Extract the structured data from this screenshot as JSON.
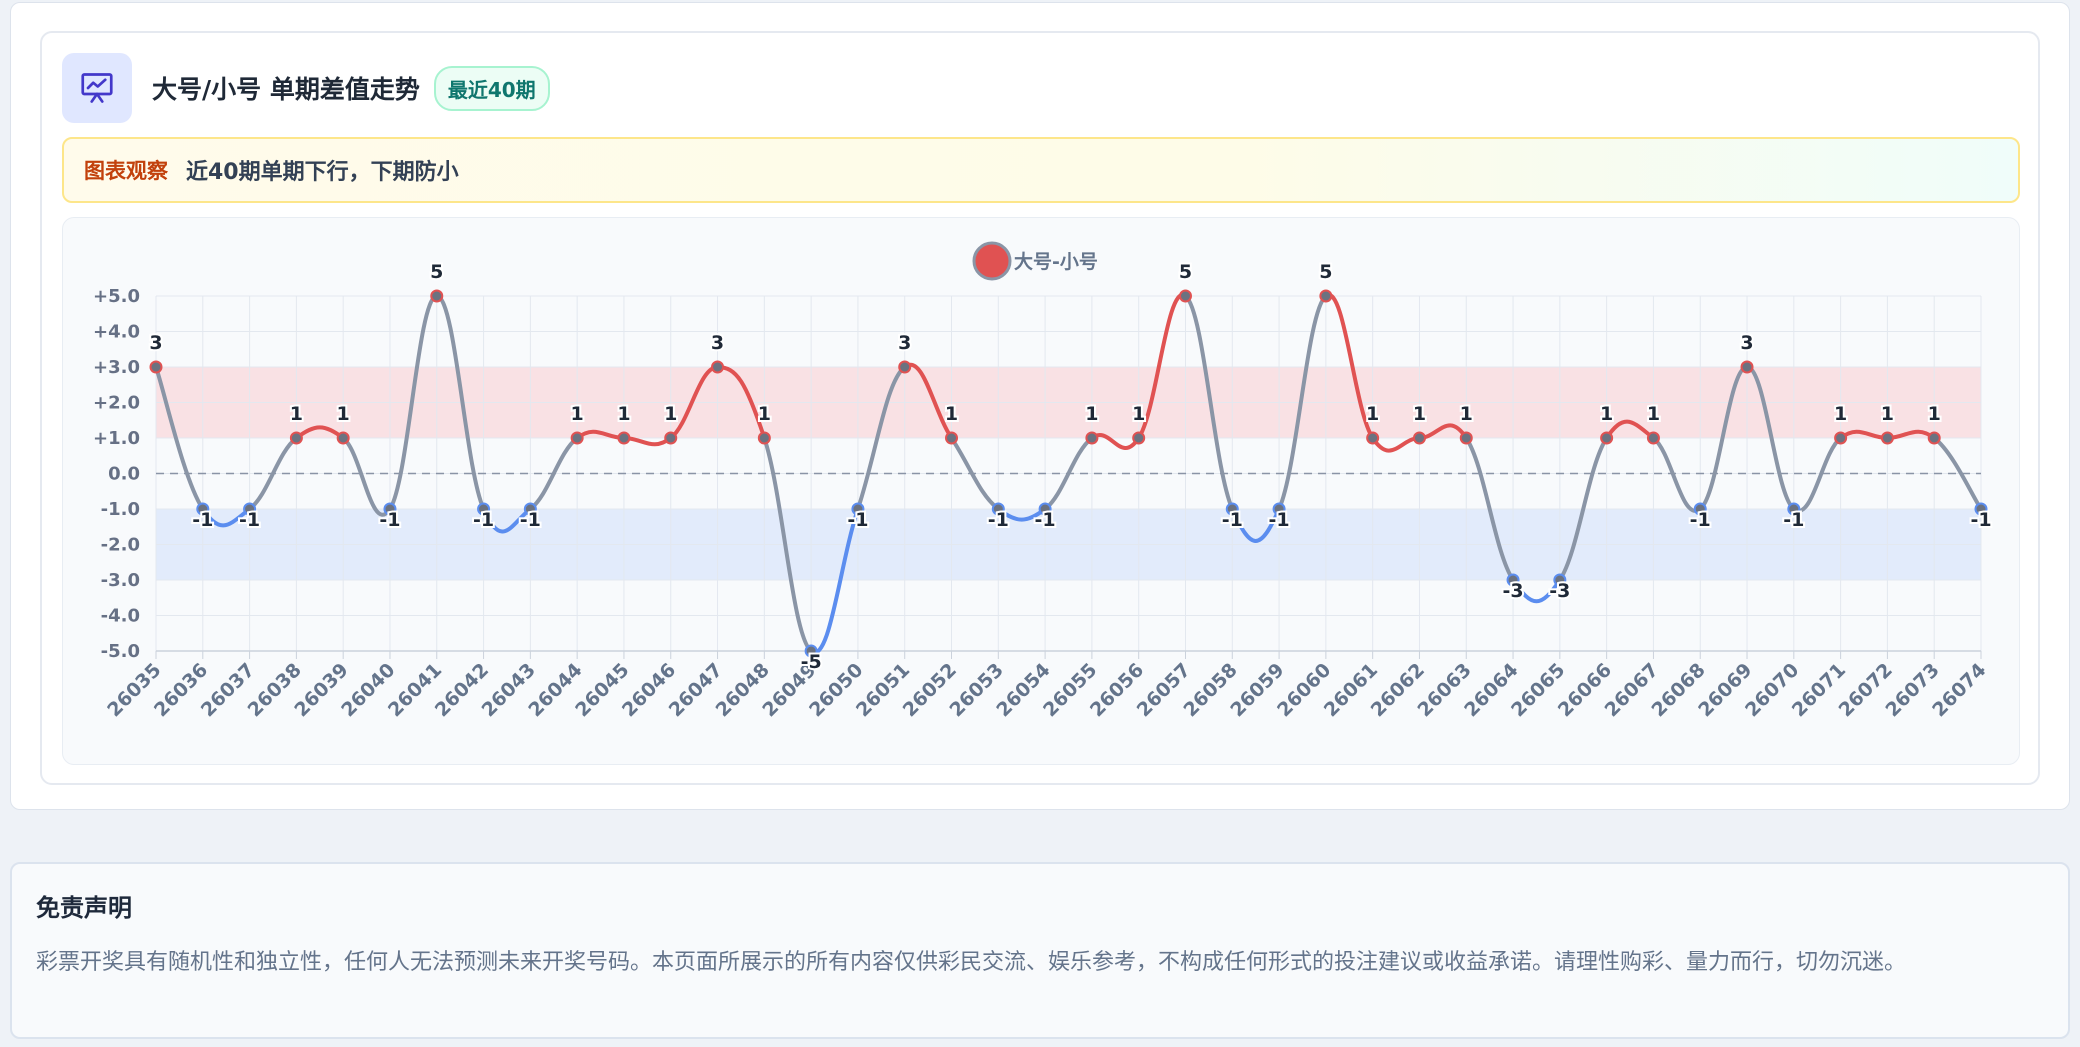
{
  "card": {
    "title": "大号/小号 单期差值走势",
    "badge": "最近40期",
    "insight_label": "图表观察",
    "insight_text": "近40期单期下行，下期防小"
  },
  "disclaimer": {
    "title": "免责声明",
    "text": "彩票开奖具有随机性和独立性，任何人无法预测未来开奖号码。本页面所展示的所有内容仅供彩民交流、娱乐参考，不构成任何形式的投注建议或收益承诺。请理性购彩、量力而行，切勿沉迷。"
  },
  "colors": {
    "up": "#e05252",
    "down": "#5b8def",
    "flat": "#8a95a6",
    "band_high": "#f9e1e4",
    "band_low": "#e2ebfb"
  },
  "chart_data": {
    "type": "line",
    "legend": "大号-小号",
    "legend_position": "top-center",
    "ylim": [
      -5,
      5
    ],
    "y_ticks": [
      "+5.0",
      "+4.0",
      "+3.0",
      "+2.0",
      "+1.0",
      "0.0",
      "-1.0",
      "-2.0",
      "-3.0",
      "-4.0",
      "-5.0"
    ],
    "high_band": [
      1,
      3
    ],
    "low_band": [
      -3,
      -1
    ],
    "zero_line": 0,
    "grid": true,
    "x": [
      "26035",
      "26036",
      "26037",
      "26038",
      "26039",
      "26040",
      "26041",
      "26042",
      "26043",
      "26044",
      "26045",
      "26046",
      "26047",
      "26048",
      "26049",
      "26050",
      "26051",
      "26052",
      "26053",
      "26054",
      "26055",
      "26056",
      "26057",
      "26058",
      "26059",
      "26060",
      "26061",
      "26062",
      "26063",
      "26064",
      "26065",
      "26066",
      "26067",
      "26068",
      "26069",
      "26070",
      "26071",
      "26072",
      "26073",
      "26074"
    ],
    "series": [
      {
        "name": "大号-小号",
        "values": [
          3,
          -1,
          -1,
          1,
          1,
          -1,
          5,
          -1,
          -1,
          1,
          1,
          1,
          3,
          1,
          -5,
          -1,
          3,
          1,
          -1,
          -1,
          1,
          1,
          5,
          -1,
          -1,
          5,
          1,
          1,
          1,
          -3,
          -3,
          1,
          1,
          -1,
          3,
          -1,
          1,
          1,
          1,
          -1
        ]
      }
    ]
  }
}
